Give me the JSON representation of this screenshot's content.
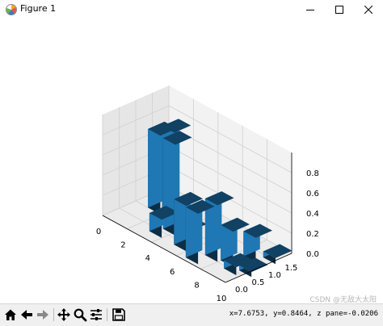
{
  "window": {
    "title": "Figure 1",
    "controls": [
      "minimize",
      "maximize",
      "close"
    ]
  },
  "toolbar": {
    "buttons": [
      {
        "name": "home",
        "icon": "home-icon"
      },
      {
        "name": "back",
        "icon": "arrow-left-icon"
      },
      {
        "name": "forward",
        "icon": "arrow-right-icon"
      },
      {
        "name": "pan",
        "icon": "move-icon"
      },
      {
        "name": "zoom",
        "icon": "magnifier-icon"
      },
      {
        "name": "configure-subplots",
        "icon": "sliders-icon"
      },
      {
        "name": "save",
        "icon": "floppy-disk-icon"
      }
    ],
    "coordinates": "x=7.6753, y=0.8464, z pane=-0.0206"
  },
  "watermark": "CSDN @无敌大太阳",
  "chart_data": {
    "type": "bar3d",
    "title": "",
    "xlabel": "",
    "ylabel": "",
    "zlabel": "",
    "xlim": [
      0,
      10
    ],
    "ylim": [
      0,
      2
    ],
    "zlim": [
      0,
      1
    ],
    "x_ticks": [
      "0",
      "2",
      "4",
      "6",
      "8",
      "10"
    ],
    "y_ticks": [
      "0.0",
      "0.5",
      "1.0",
      "1.5"
    ],
    "z_ticks": [
      "0.0",
      "0.2",
      "0.4",
      "0.6",
      "0.8"
    ],
    "color": "#1f77b4",
    "bars": [
      {
        "x": 1,
        "y": 1,
        "dx": 1,
        "dy": 0.5,
        "z": 0,
        "dz": 0.78
      },
      {
        "x": 1.6,
        "y": 1.2,
        "dx": 1,
        "dy": 0.5,
        "z": 0,
        "dz": 0.82
      },
      {
        "x": 3,
        "y": 0.3,
        "dx": 1,
        "dy": 0.5,
        "z": 0,
        "dz": 0.18
      },
      {
        "x": 3.3,
        "y": 0.6,
        "dx": 1,
        "dy": 0.5,
        "z": 0,
        "dz": 0.9
      },
      {
        "x": 4.5,
        "y": 0.6,
        "dx": 1,
        "dy": 0.5,
        "z": 0,
        "dz": 0.12
      },
      {
        "x": 5,
        "y": 0.3,
        "dx": 1,
        "dy": 0.5,
        "z": 0,
        "dz": 0.45
      },
      {
        "x": 6.5,
        "y": 0.1,
        "dx": 1,
        "dy": 0.5,
        "z": 0,
        "dz": 0.5
      },
      {
        "x": 7,
        "y": 0.5,
        "dx": 1,
        "dy": 0.5,
        "z": 0,
        "dz": 0.56
      },
      {
        "x": 8,
        "y": 0.6,
        "dx": 1,
        "dy": 0.5,
        "z": 0,
        "dz": 0.35
      },
      {
        "x": 8.5,
        "y": 1.1,
        "dx": 1,
        "dy": 0.5,
        "z": 0,
        "dz": 0.25
      },
      {
        "x": 8.8,
        "y": 0.4,
        "dx": 1,
        "dy": 0.5,
        "z": 0,
        "dz": 0.08
      },
      {
        "x": 9.5,
        "y": 0.6,
        "dx": 1,
        "dy": 0.5,
        "z": 0,
        "dz": 0.05
      },
      {
        "x": 9.3,
        "y": 1.4,
        "dx": 1,
        "dy": 0.5,
        "z": 0,
        "dz": 0.06
      }
    ]
  }
}
